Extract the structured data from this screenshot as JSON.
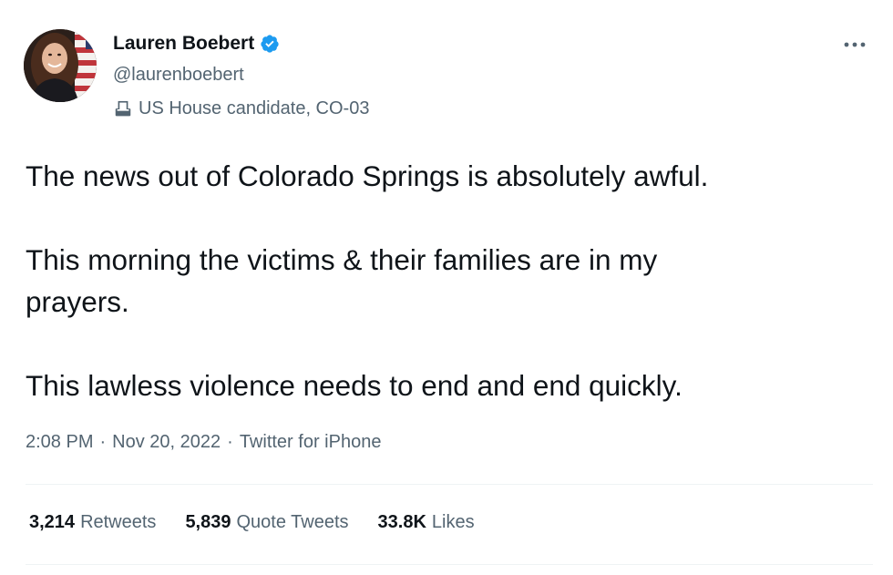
{
  "author": {
    "display_name": "Lauren Boebert",
    "handle": "@laurenboebert",
    "label": "US House candidate, CO-03",
    "verified_color": "#1d9bf0"
  },
  "tweet": {
    "paragraphs": [
      "The news out of Colorado Springs is absolutely awful.",
      "This morning the victims & their families are in my\nprayers.",
      "This lawless violence needs to end and end quickly."
    ],
    "time": "2:08 PM",
    "date": "Nov 20, 2022",
    "source": "Twitter for iPhone",
    "separator": "·"
  },
  "stats": {
    "retweets": {
      "count": "3,214",
      "label": "Retweets"
    },
    "quote_tweets": {
      "count": "5,839",
      "label": "Quote Tweets"
    },
    "likes": {
      "count": "33.8K",
      "label": "Likes"
    }
  },
  "icons": {
    "verified": "verified-badge-icon",
    "label": "ballot-box-icon",
    "more": "more-options-icon"
  },
  "colors": {
    "text_primary": "#0f1419",
    "text_secondary": "#536471",
    "divider": "#eff3f4"
  }
}
